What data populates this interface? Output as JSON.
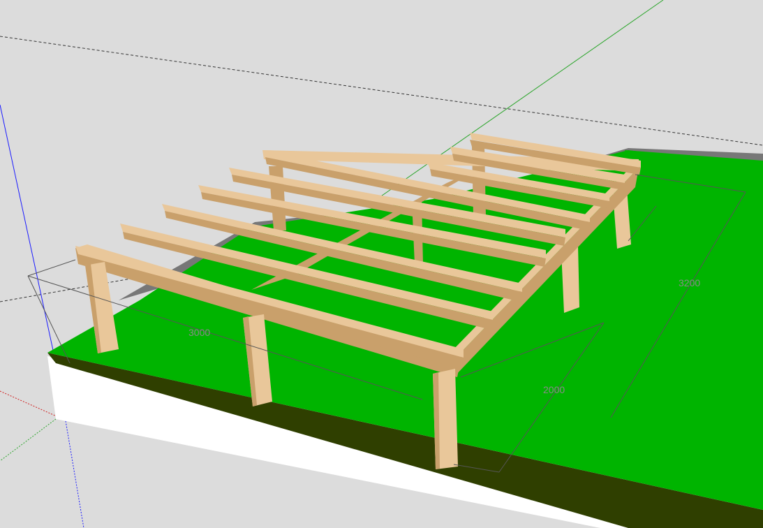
{
  "viewport": {
    "colors": {
      "sky": "#dcdcdc",
      "ground": "#00b400",
      "ground_edge": "#2f3f00",
      "base_side": "#ffffff",
      "wood": "#e9c79a",
      "wood_side": "#c9a06b",
      "wood_dark": "#a87a48",
      "dim_line": "#555555",
      "axis_blue": "#1a1aff",
      "axis_green": "#2aa52a",
      "axis_red": "#d02020"
    }
  },
  "dimensions": {
    "width_label": "3000",
    "depth_label": "3200",
    "joist_label": "2000"
  }
}
